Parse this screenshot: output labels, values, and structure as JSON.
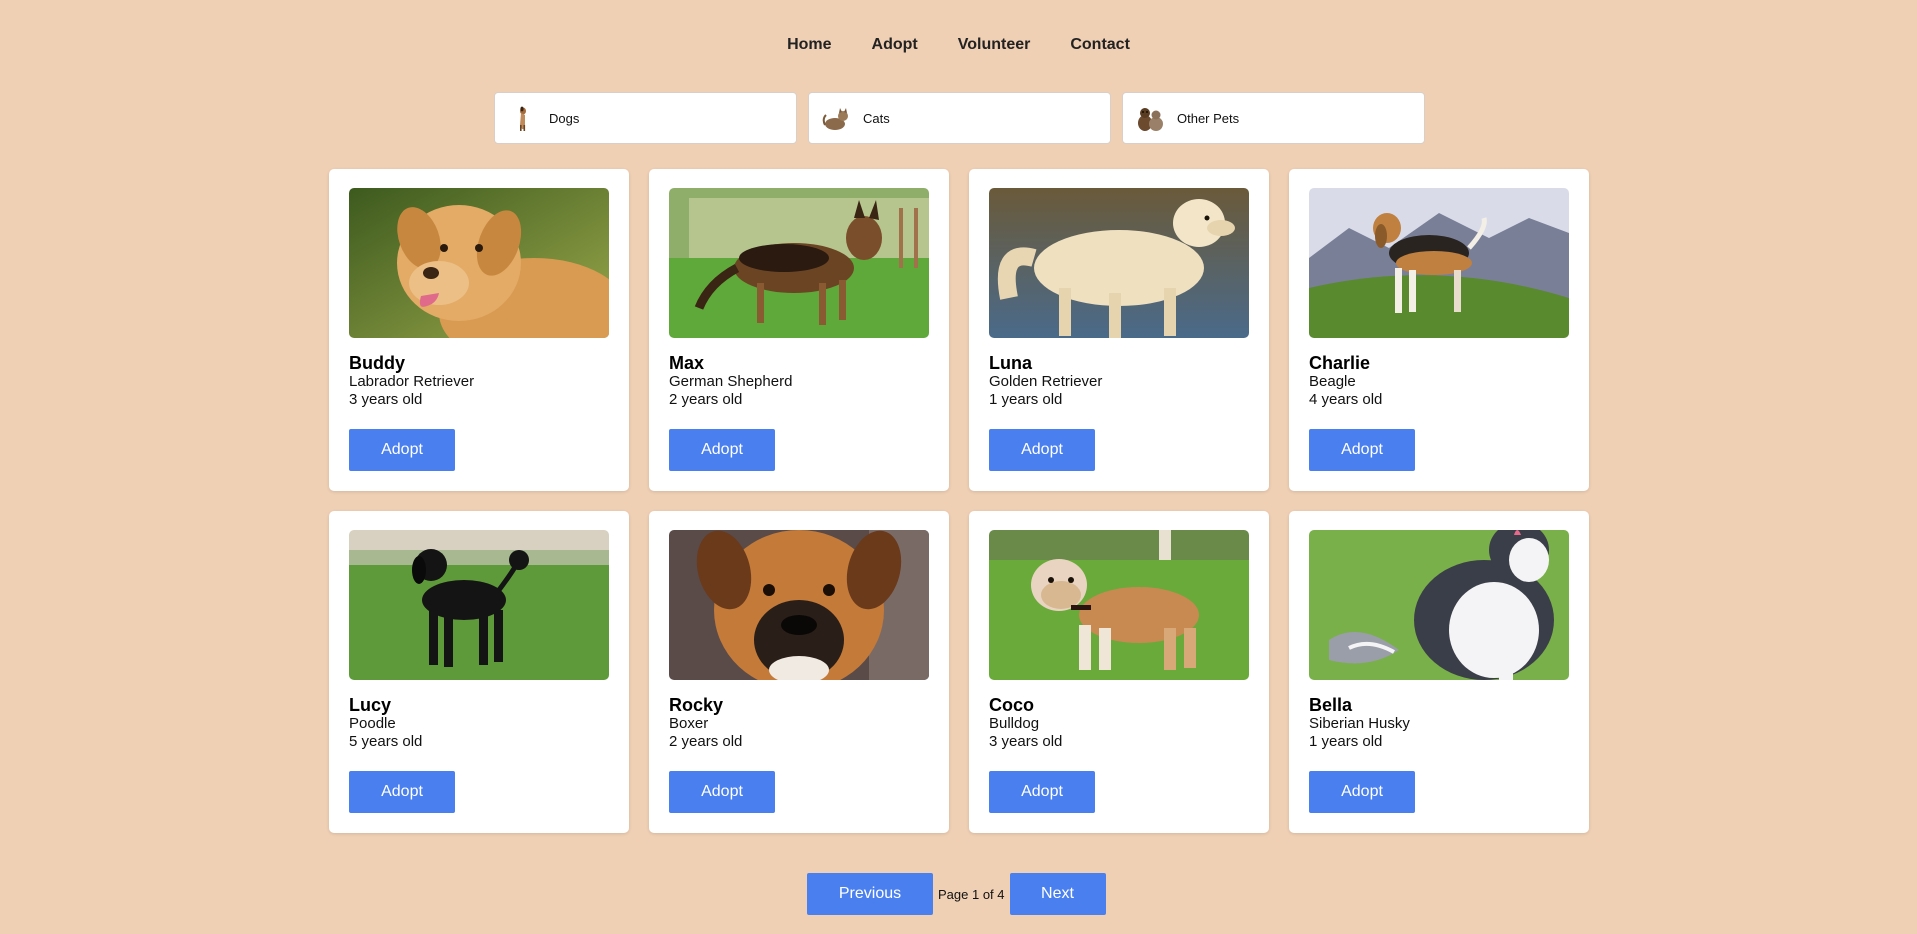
{
  "nav": {
    "items": [
      {
        "label": "Home"
      },
      {
        "label": "Adopt"
      },
      {
        "label": "Volunteer"
      },
      {
        "label": "Contact"
      }
    ]
  },
  "categories": [
    {
      "label": "Dogs",
      "icon": "dog-icon"
    },
    {
      "label": "Cats",
      "icon": "cat-icon"
    },
    {
      "label": "Other Pets",
      "icon": "other-pets-icon"
    }
  ],
  "pets": [
    {
      "name": "Buddy",
      "breed": "Labrador Retriever",
      "age": "3 years old",
      "adopt_label": "Adopt",
      "photo": "labrador-photo"
    },
    {
      "name": "Max",
      "breed": "German Shepherd",
      "age": "2 years old",
      "adopt_label": "Adopt",
      "photo": "german-shepherd-photo"
    },
    {
      "name": "Luna",
      "breed": "Golden Retriever",
      "age": "1 years old",
      "adopt_label": "Adopt",
      "photo": "golden-retriever-photo"
    },
    {
      "name": "Charlie",
      "breed": "Beagle",
      "age": "4 years old",
      "adopt_label": "Adopt",
      "photo": "beagle-photo"
    },
    {
      "name": "Lucy",
      "breed": "Poodle",
      "age": "5 years old",
      "adopt_label": "Adopt",
      "photo": "poodle-photo"
    },
    {
      "name": "Rocky",
      "breed": "Boxer",
      "age": "2 years old",
      "adopt_label": "Adopt",
      "photo": "boxer-photo"
    },
    {
      "name": "Coco",
      "breed": "Bulldog",
      "age": "3 years old",
      "adopt_label": "Adopt",
      "photo": "bulldog-photo"
    },
    {
      "name": "Bella",
      "breed": "Siberian Husky",
      "age": "1 years old",
      "adopt_label": "Adopt",
      "photo": "husky-photo"
    }
  ],
  "pagination": {
    "previous_label": "Previous",
    "info": "Page 1 of 4",
    "next_label": "Next"
  },
  "colors": {
    "background": "#f0d0b4",
    "button": "#4a7ff0",
    "card": "#ffffff"
  }
}
